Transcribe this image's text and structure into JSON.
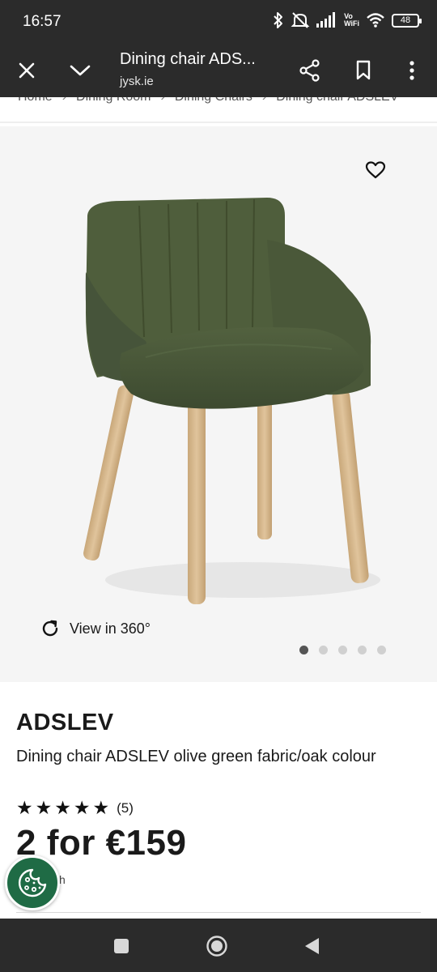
{
  "status_bar": {
    "time": "16:57",
    "network_label_top": "Vo",
    "network_label_bottom": "WiFi",
    "battery": "48",
    "icons": [
      "bluetooth-icon",
      "mute-icon",
      "signal-icon",
      "wifi-icon",
      "battery-icon"
    ]
  },
  "toolbar": {
    "title": "Dining chair ADS...",
    "domain": "jysk.ie",
    "icons": [
      "close-icon",
      "chevron-down-icon",
      "share-icon",
      "bookmark-icon",
      "more-vert-icon"
    ]
  },
  "breadcrumb": {
    "items": [
      "Home",
      "Dining Room",
      "Dining Chairs",
      "Dining chair ADSLEV"
    ],
    "separator": "›"
  },
  "gallery": {
    "view360_label": "View in 360°",
    "slide_count": 5,
    "active_slide": 1,
    "chair_color": "#4a5a3a",
    "leg_color": "#d4b68c"
  },
  "product": {
    "brand": "ADSLEV",
    "description": "Dining chair ADSLEV olive green fabric/oak colour",
    "rating": 5,
    "review_count": "(5)",
    "price": "2 for €159",
    "price_unit": "ch"
  },
  "colors": {
    "system_bar": "#2b2b2b",
    "gallery_bg": "#f5f5f5",
    "cookie_button": "#1f6b45"
  }
}
